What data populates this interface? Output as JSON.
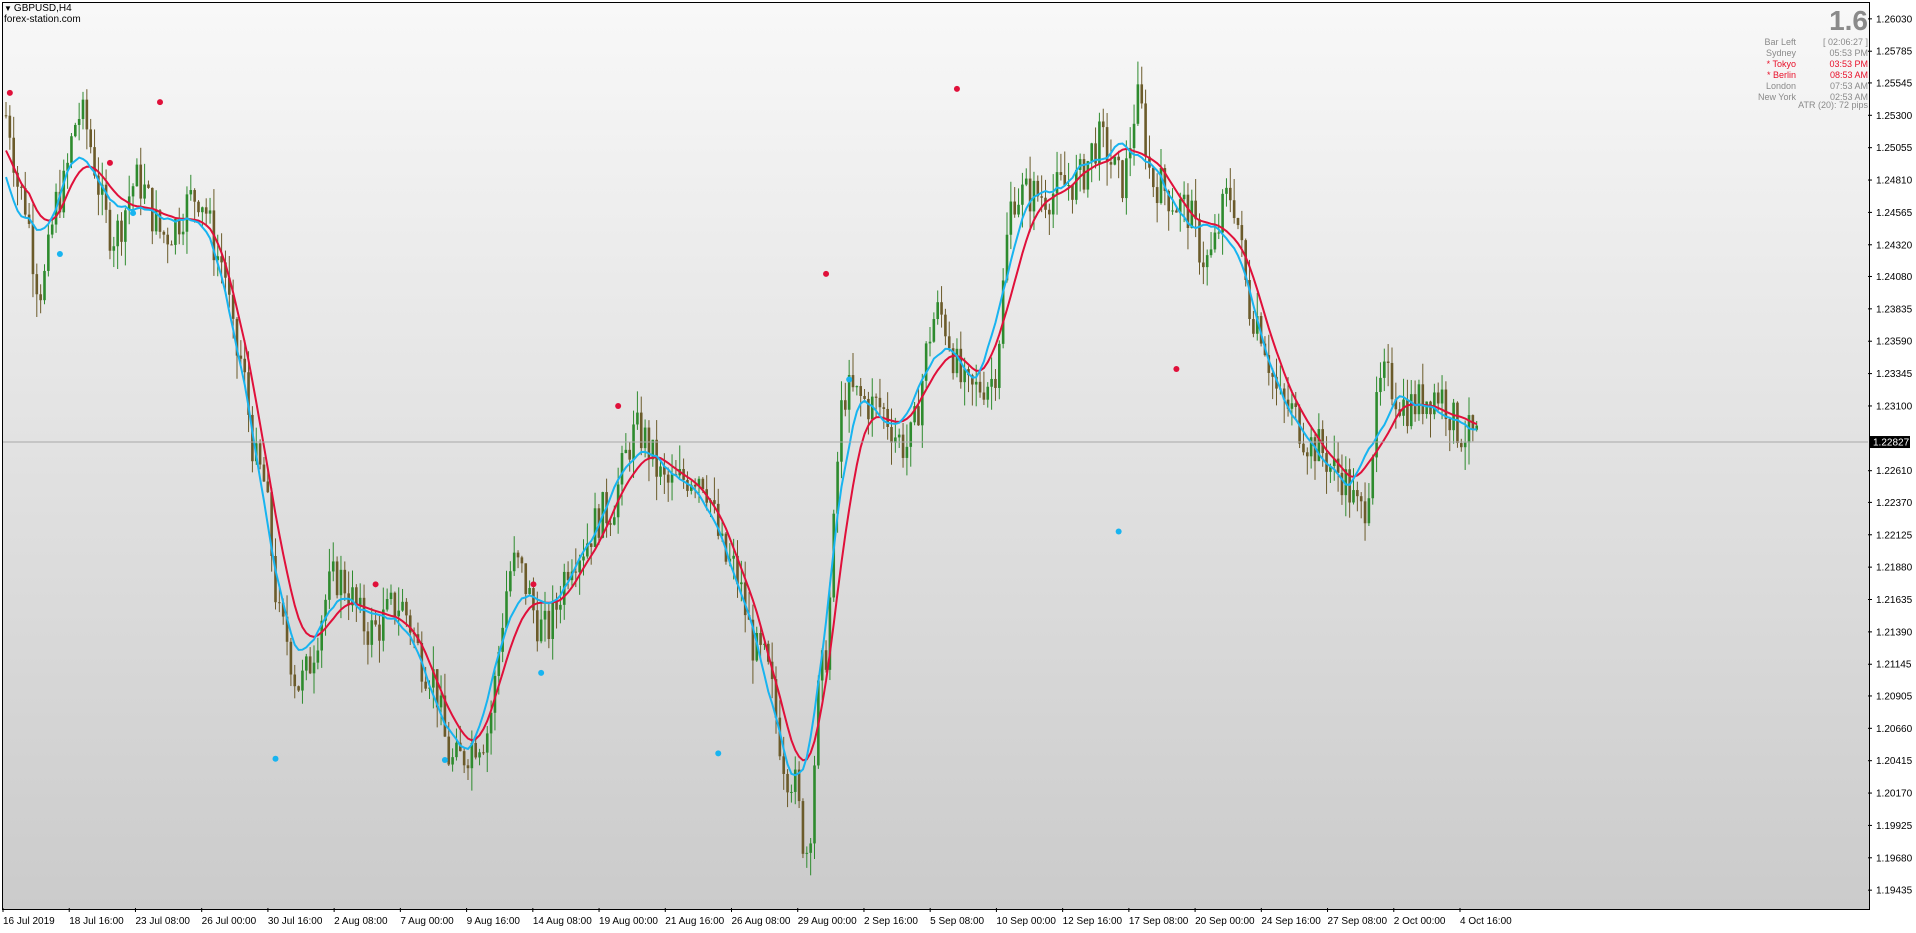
{
  "header": {
    "symbol": "GBPUSD,H4",
    "watermark": "forex-station.com"
  },
  "info_panel": {
    "value": "1.6",
    "rows": [
      {
        "label": "Bar Left",
        "value": "[ 02:06:27 ]",
        "active": false
      },
      {
        "label": "Sydney",
        "value": "05:53 PM",
        "active": false
      },
      {
        "label": "* Tokyo",
        "value": "03:53 PM",
        "active": true
      },
      {
        "label": "* Berlin",
        "value": "08:53 AM",
        "active": true
      },
      {
        "label": "London",
        "value": "07:53 AM",
        "active": false
      },
      {
        "label": "New York",
        "value": "02:53 AM",
        "active": false
      }
    ],
    "atr": "ATR (20): 72 pips"
  },
  "colors": {
    "bull": "#2e8b2e",
    "bear": "#6b5b2a",
    "fast_line": "#18b4f0",
    "slow_line": "#e0103a",
    "current_price_bg": "#000000",
    "current_price_fg": "#ffffff"
  },
  "chart_data": {
    "type": "candlestick",
    "symbol": "GBPUSD",
    "timeframe": "H4",
    "y_range": [
      1.193,
      1.2615
    ],
    "price_ticks": [
      "1.26030",
      "1.25785",
      "1.25545",
      "1.25300",
      "1.25055",
      "1.24810",
      "1.24565",
      "1.24320",
      "1.24080",
      "1.23835",
      "1.23590",
      "1.23345",
      "1.23100",
      "1.22610",
      "1.22370",
      "1.22125",
      "1.21880",
      "1.21635",
      "1.21390",
      "1.21145",
      "1.20905",
      "1.20660",
      "1.20415",
      "1.20170",
      "1.19925",
      "1.19680",
      "1.19435"
    ],
    "current_price": "1.22827",
    "time_ticks": [
      "16 Jul 2019",
      "18 Jul 16:00",
      "23 Jul 08:00",
      "26 Jul 00:00",
      "30 Jul 16:00",
      "2 Aug 08:00",
      "7 Aug 00:00",
      "9 Aug 16:00",
      "14 Aug 08:00",
      "19 Aug 00:00",
      "21 Aug 16:00",
      "26 Aug 08:00",
      "29 Aug 00:00",
      "2 Sep 16:00",
      "5 Sep 08:00",
      "10 Sep 00:00",
      "12 Sep 16:00",
      "17 Sep 08:00",
      "20 Sep 00:00",
      "24 Sep 16:00",
      "27 Sep 08:00",
      "2 Oct 00:00",
      "4 Oct 16:00"
    ],
    "price_path_keypoints": [
      [
        0,
        1.253
      ],
      [
        4,
        1.247
      ],
      [
        9,
        1.24
      ],
      [
        14,
        1.247
      ],
      [
        19,
        1.253
      ],
      [
        28,
        1.244
      ],
      [
        34,
        1.248
      ],
      [
        41,
        1.244
      ],
      [
        50,
        1.247
      ],
      [
        56,
        1.242
      ],
      [
        60,
        1.235
      ],
      [
        66,
        1.226
      ],
      [
        72,
        1.214
      ],
      [
        76,
        1.21
      ],
      [
        86,
        1.218
      ],
      [
        95,
        1.214
      ],
      [
        102,
        1.216
      ],
      [
        110,
        1.211
      ],
      [
        116,
        1.204
      ],
      [
        124,
        1.206
      ],
      [
        132,
        1.219
      ],
      [
        140,
        1.214
      ],
      [
        148,
        1.22
      ],
      [
        156,
        1.223
      ],
      [
        164,
        1.229
      ],
      [
        172,
        1.225
      ],
      [
        180,
        1.226
      ],
      [
        188,
        1.219
      ],
      [
        196,
        1.212
      ],
      [
        204,
        1.203
      ],
      [
        208,
        1.1975
      ],
      [
        212,
        1.211
      ],
      [
        218,
        1.232
      ],
      [
        226,
        1.231
      ],
      [
        234,
        1.228
      ],
      [
        242,
        1.238
      ],
      [
        250,
        1.232
      ],
      [
        256,
        1.233
      ],
      [
        262,
        1.247
      ],
      [
        270,
        1.247
      ],
      [
        278,
        1.248
      ],
      [
        284,
        1.251
      ],
      [
        290,
        1.248
      ],
      [
        294,
        1.254
      ],
      [
        298,
        1.248
      ],
      [
        306,
        1.246
      ],
      [
        312,
        1.242
      ],
      [
        318,
        1.247
      ],
      [
        324,
        1.238
      ],
      [
        332,
        1.231
      ],
      [
        340,
        1.228
      ],
      [
        346,
        1.226
      ],
      [
        352,
        1.223
      ],
      [
        358,
        1.233
      ],
      [
        364,
        1.231
      ],
      [
        372,
        1.232
      ],
      [
        378,
        1.229
      ],
      [
        382,
        1.2285
      ]
    ],
    "series": [
      {
        "name": "",
        "color": "#18b4f0",
        "role": "fast moving average"
      },
      {
        "name": "",
        "color": "#e0103a",
        "role": "slow moving average"
      }
    ],
    "signal_dots": {
      "red": [
        [
          1,
          1.2547
        ],
        [
          27,
          1.2494
        ],
        [
          40,
          1.254
        ],
        [
          96,
          1.2175
        ],
        [
          137,
          1.2175
        ],
        [
          159,
          1.231
        ],
        [
          213,
          1.241
        ],
        [
          247,
          1.255
        ],
        [
          304,
          1.2338
        ]
      ],
      "blue": [
        [
          14,
          1.2425
        ],
        [
          33,
          1.2456
        ],
        [
          70,
          1.2043
        ],
        [
          114,
          1.2042
        ],
        [
          139,
          1.2108
        ],
        [
          185,
          1.2047
        ],
        [
          219,
          1.233
        ],
        [
          289,
          1.2215
        ]
      ]
    }
  }
}
